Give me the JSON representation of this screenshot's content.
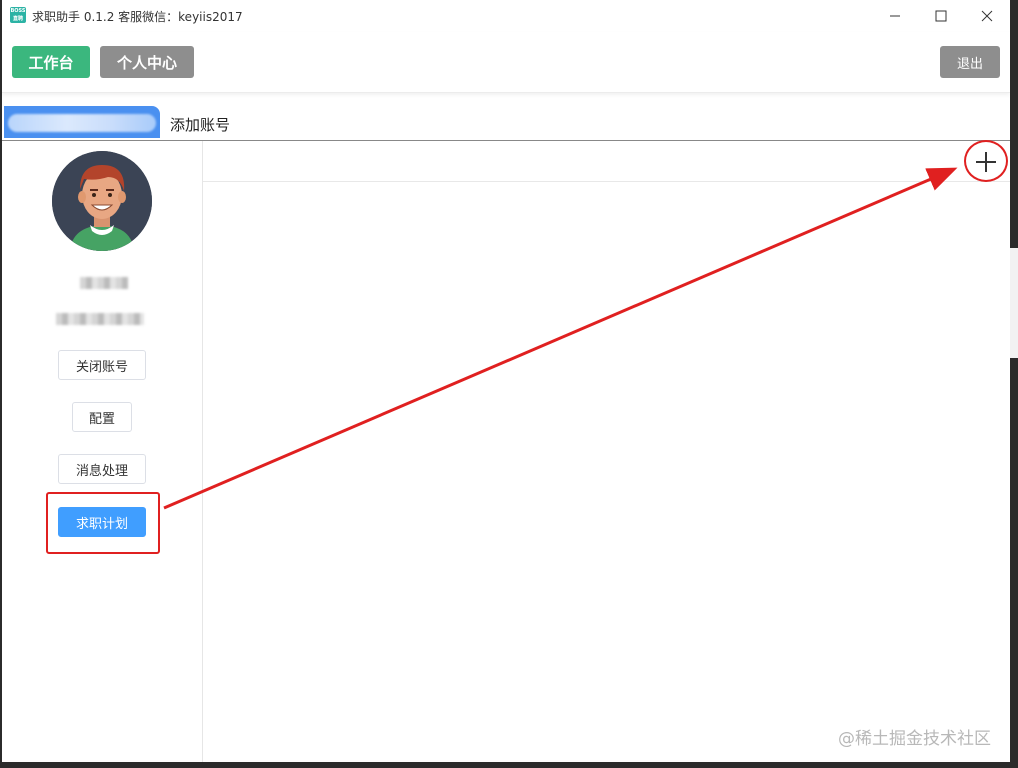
{
  "window": {
    "title": "求职助手 0.1.2 客服微信：keyiis2017",
    "app_icon_text": "BOSS\n直聘"
  },
  "toolbar": {
    "workspace_label": "工作台",
    "personal_center_label": "个人中心",
    "logout_label": "退出"
  },
  "tabs": {
    "add_account_label": "添加账号"
  },
  "sidebar": {
    "close_account_label": "关闭账号",
    "config_label": "配置",
    "message_label": "消息处理",
    "job_plan_label": "求职计划"
  },
  "colors": {
    "green": "#3bb77e",
    "gray": "#8e8e8e",
    "blue": "#409eff",
    "tab_blue": "#4a90f0",
    "annotation_red": "#e02020"
  },
  "watermark": "@稀土掘金技术社区"
}
